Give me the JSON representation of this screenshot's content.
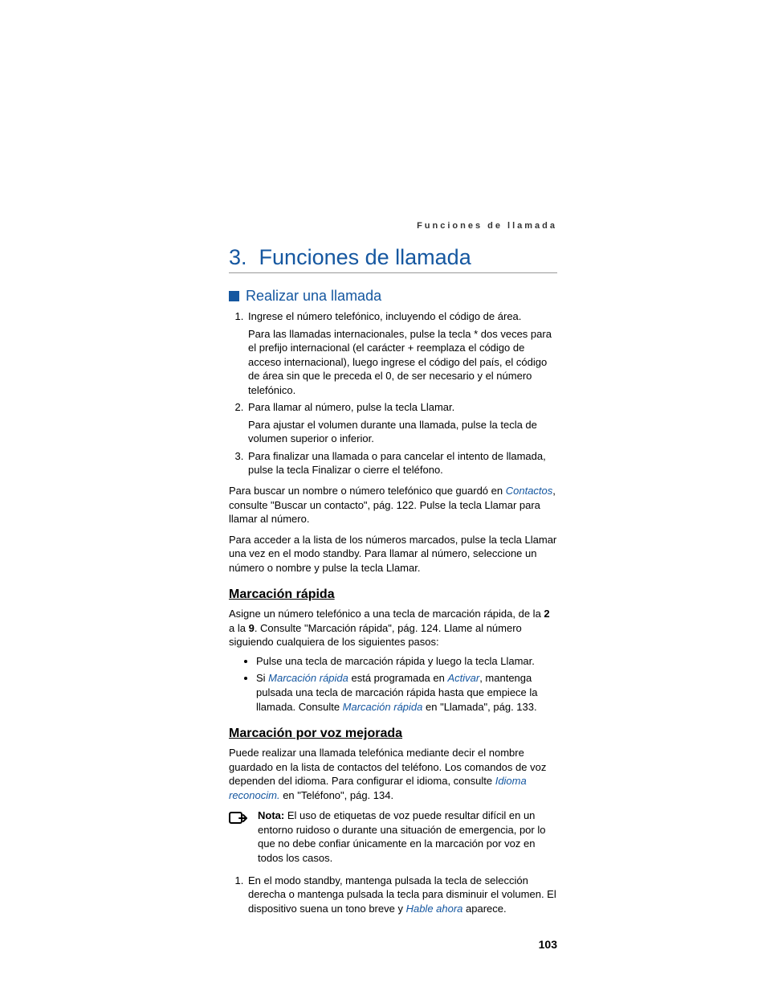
{
  "running_header": "Funciones de llamada",
  "chapter": {
    "number": "3.",
    "title": "Funciones de llamada"
  },
  "section1": {
    "title": "Realizar una llamada",
    "step1": "Ingrese el número telefónico, incluyendo el código de área.",
    "step1_sub": "Para las llamadas internacionales, pulse la tecla * dos veces para el prefijo internacional (el carácter + reemplaza el código de acceso internacional), luego ingrese el código del país, el código de área sin que le preceda el 0, de ser necesario y el número telefónico.",
    "step2": "Para llamar al número, pulse la tecla Llamar.",
    "step2_sub": "Para ajustar el volumen durante una llamada, pulse la tecla de volumen superior o inferior.",
    "step3": "Para finalizar una llamada o para cancelar el intento de llamada, pulse la tecla Finalizar o cierre el teléfono.",
    "para1_a": "Para buscar un nombre o número telefónico que guardó en ",
    "para1_link": "Contactos",
    "para1_b": ", consulte \"Buscar un contacto\", pág. 122. Pulse la tecla Llamar para llamar al número.",
    "para2": "Para acceder a la lista de los números marcados, pulse la tecla Llamar una vez en el modo standby. Para llamar al número, seleccione un número o nombre y pulse la tecla Llamar."
  },
  "sub1": {
    "title": "Marcación rápida",
    "intro_a": "Asigne un número telefónico a una tecla de marcación rápida, de la ",
    "intro_b": " a la ",
    "intro_c": ". Consulte \"Marcación rápida\", pág. 124. Llame al número siguiendo cualquiera de los siguientes pasos:",
    "key_from": "2",
    "key_to": "9",
    "bullet1": "Pulse una tecla de marcación rápida y luego la tecla Llamar.",
    "bullet2_a": "Si ",
    "bullet2_link1": "Marcación rápida",
    "bullet2_b": " está programada en ",
    "bullet2_link2": "Activar",
    "bullet2_c": ", mantenga pulsada una tecla de marcación rápida hasta que empiece la llamada. Consulte ",
    "bullet2_link3": "Marcación rápida",
    "bullet2_d": " en \"Llamada\", pág. 133."
  },
  "sub2": {
    "title": "Marcación por voz mejorada",
    "para_a": "Puede realizar una llamada telefónica mediante decir el nombre guardado en la lista de contactos del teléfono. Los comandos de voz dependen del idioma. Para configurar el idioma, consulte ",
    "para_link": "Idioma reconocim.",
    "para_b": " en \"Teléfono\", pág. 134.",
    "note_label": "Nota:",
    "note_body": " El uso de etiquetas de voz puede resultar difícil en un entorno ruidoso o durante una situación de emergencia, por lo que no debe confiar únicamente en la marcación por voz en todos los casos.",
    "step1_a": "En el modo standby, mantenga pulsada la tecla de selección derecha o mantenga pulsada la tecla para disminuir el volumen. El dispositivo suena un tono breve y ",
    "step1_link": "Hable ahora",
    "step1_b": " aparece."
  },
  "page_number": "103"
}
